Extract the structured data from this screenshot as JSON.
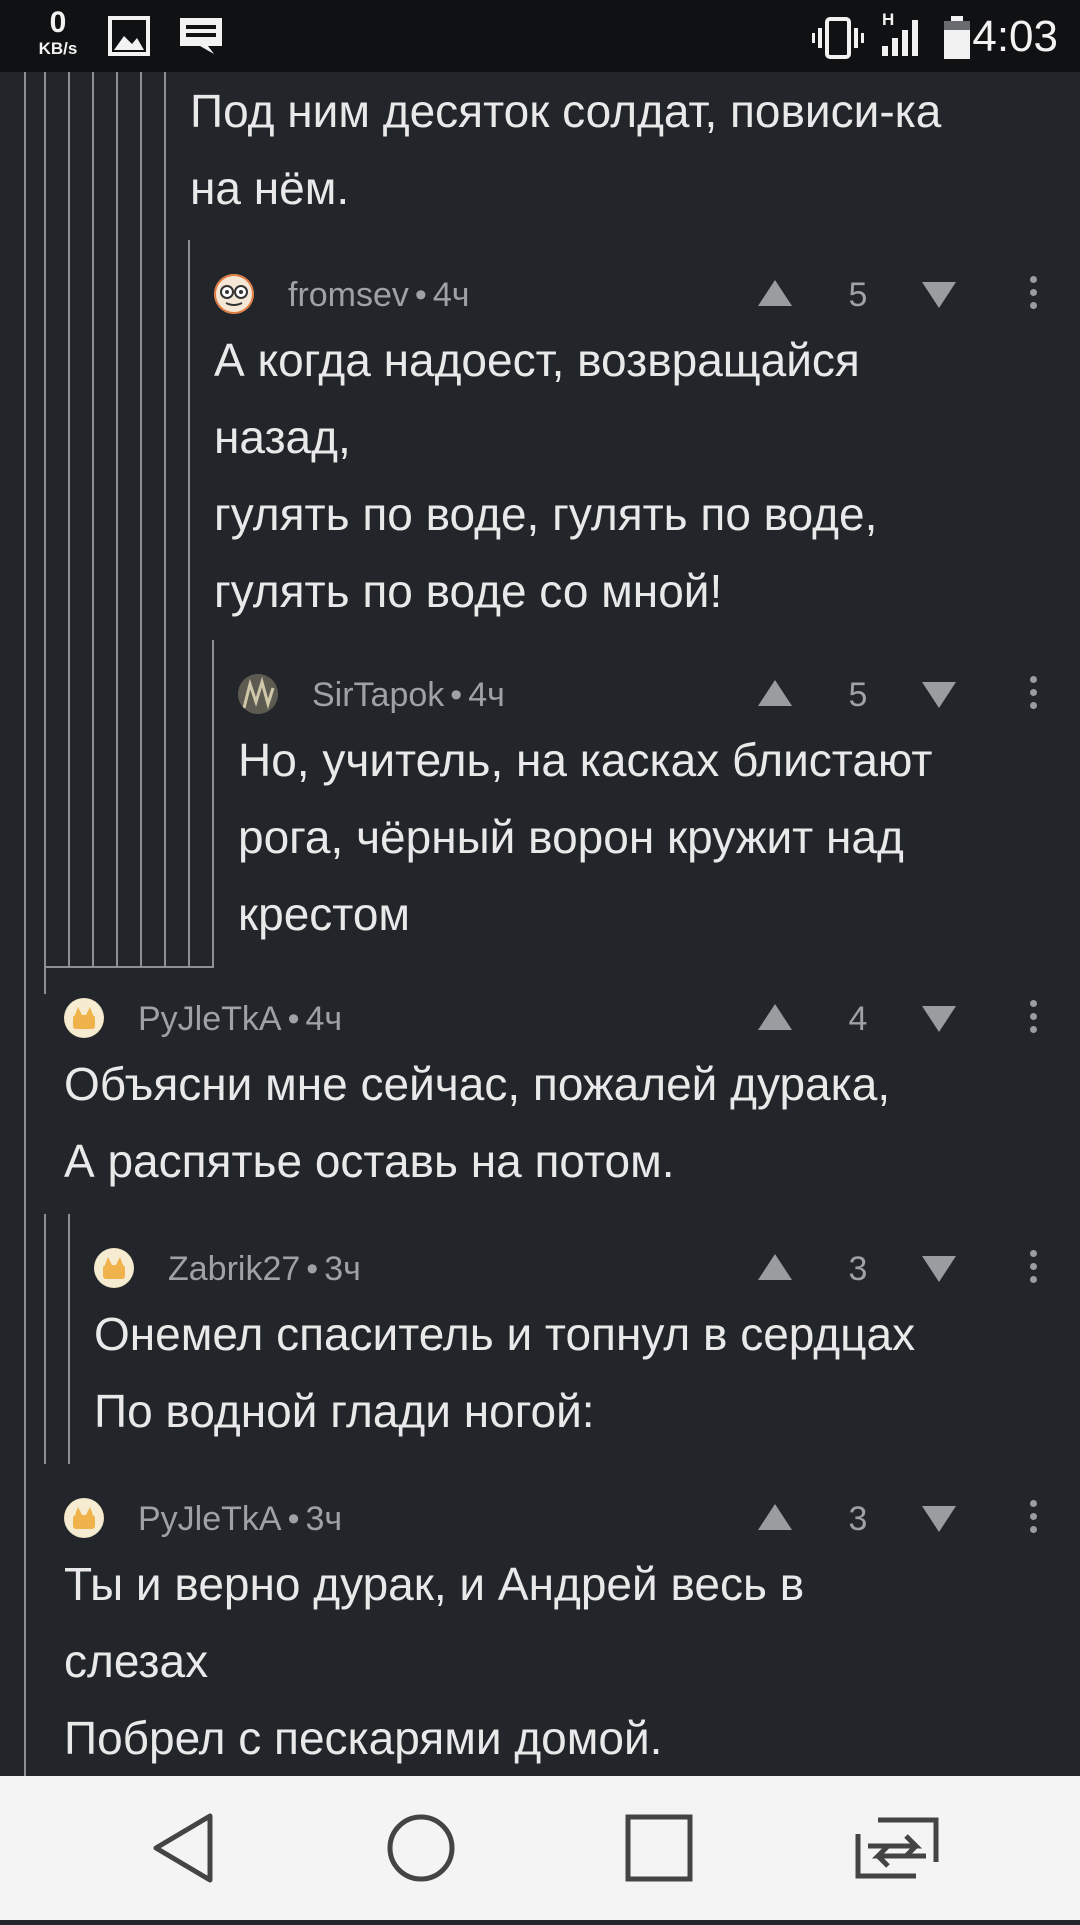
{
  "status_bar": {
    "speed_value": "0",
    "speed_unit": "KB/s",
    "network_label": "H",
    "time": "4:03",
    "icons": [
      "image-icon",
      "message-icon",
      "vibrate-icon",
      "signal-icon",
      "battery-icon"
    ]
  },
  "top_text": "Под ним десяток солдат, повиси-ка\nна нём.",
  "comments": [
    {
      "author": "fromsev",
      "time": "4ч",
      "score": "5",
      "text": "А когда надоест, возвращайся\nназад,\nгулять по воде, гулять по воде,\nгулять по воде со мной!"
    },
    {
      "author": "SirTapok",
      "time": "4ч",
      "score": "5",
      "text": "Но, учитель, на касках блистают\nрога, чёрный ворон кружит над\nкрестом"
    },
    {
      "author": "PyJleTkA",
      "time": "4ч",
      "score": "4",
      "text": "Объясни мне сейчас, пожалей дурака,\nА распятье оставь на потом."
    },
    {
      "author": "Zabrik27",
      "time": "3ч",
      "score": "3",
      "text": "Онемел спаситель и топнул в сердцах\nПо водной глади ногой:"
    },
    {
      "author": "PyJleTkA",
      "time": "3ч",
      "score": "3",
      "text": "Ты и верно дурак, и Андрей весь в\nслезах\nПобрел с пескарями домой."
    }
  ],
  "meta_separator": "•",
  "nav": {
    "buttons": [
      "back-icon",
      "home-icon",
      "recents-icon",
      "switch-screen-icon"
    ]
  },
  "colors": {
    "background": "#222529",
    "text": "#e9e9e9",
    "meta": "#9ea1a6",
    "thread_line": "#8d8f93",
    "nav_bar": "#f4f4f4"
  }
}
